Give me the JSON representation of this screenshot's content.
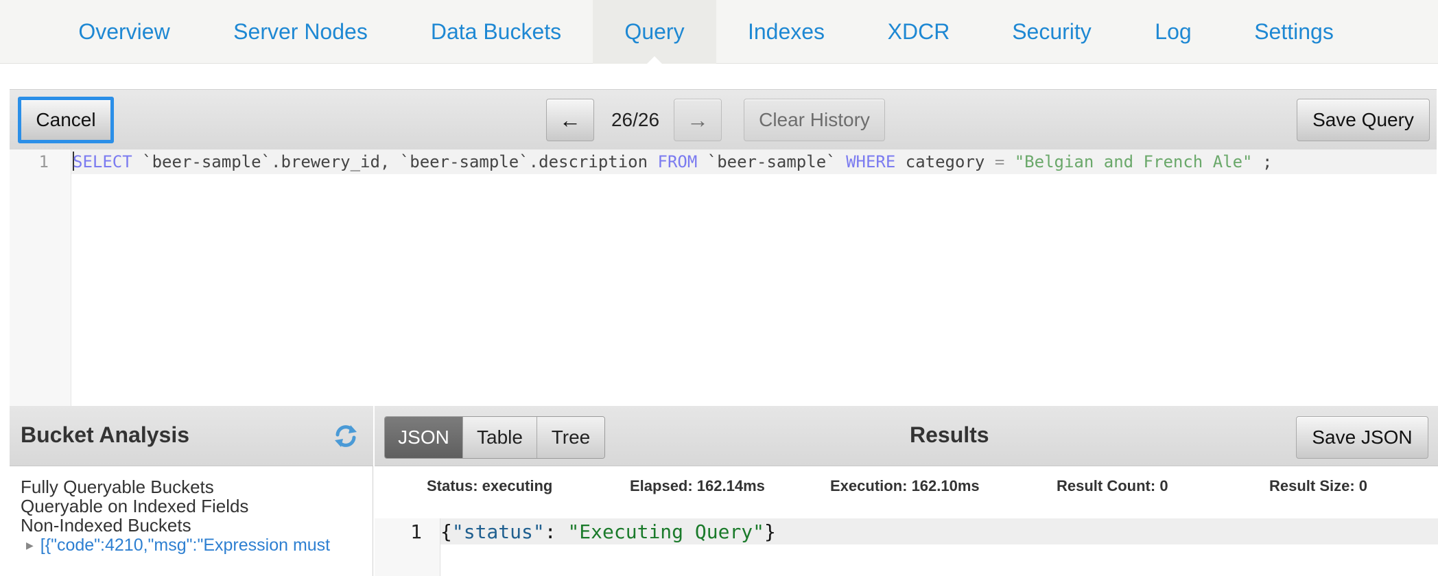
{
  "nav": {
    "tabs": [
      {
        "label": "Overview"
      },
      {
        "label": "Server Nodes"
      },
      {
        "label": "Data Buckets"
      },
      {
        "label": "Query",
        "active": true
      },
      {
        "label": "Indexes"
      },
      {
        "label": "XDCR"
      },
      {
        "label": "Security"
      },
      {
        "label": "Log"
      },
      {
        "label": "Settings"
      }
    ]
  },
  "query_toolbar": {
    "cancel_label": "Cancel",
    "prev_label": "←",
    "history_position": "26/26",
    "next_label": "→",
    "clear_history_label": "Clear History",
    "save_query_label": "Save Query"
  },
  "editor": {
    "line_number": "1",
    "tokens": {
      "select_head": "S",
      "select_tail": "ELECT",
      "part1": " `beer-sample`.brewery_id, `beer-sample`.description ",
      "from": "FROM",
      "part2": " `beer-sample` ",
      "where": "WHERE",
      "part3": " category ",
      "eq": "=",
      "space": " ",
      "literal": "\"Belgian and French Ale\"",
      "end": " ;"
    }
  },
  "bucket_analysis": {
    "title": "Bucket Analysis",
    "refresh_icon": "refresh-icon",
    "items": [
      "Fully Queryable Buckets",
      "Queryable on Indexed Fields",
      "Non-Indexed Buckets"
    ],
    "error_text": "[{\"code\":4210,\"msg\":\"Expression must"
  },
  "results": {
    "view_tabs": [
      {
        "label": "JSON",
        "active": true
      },
      {
        "label": "Table"
      },
      {
        "label": "Tree"
      }
    ],
    "title": "Results",
    "save_json_label": "Save JSON",
    "stats": {
      "status": "Status: executing",
      "elapsed": "Elapsed: 162.14ms",
      "execution": "Execution: 162.10ms",
      "result_count": "Result Count: 0",
      "result_size": "Result Size: 0"
    },
    "output": {
      "line_number": "1",
      "open": "{",
      "key": "\"status\"",
      "colon": ": ",
      "value": "\"Executing Query\"",
      "close": "}"
    }
  },
  "colors": {
    "nav_link": "#1e88d3",
    "keyword": "#7b7bf0",
    "string": "#6aa86a",
    "focus_ring": "#2b8fe8"
  }
}
